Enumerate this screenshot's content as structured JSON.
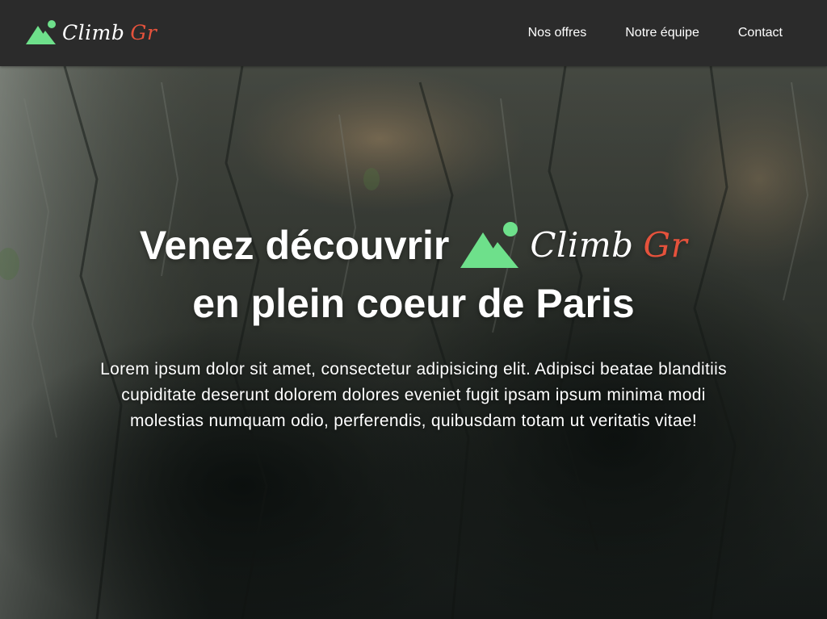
{
  "header": {
    "brand": {
      "logo_icon": "mountain-sun-logo-icon",
      "word1": "Climb",
      "word2": "Gr"
    },
    "nav": [
      "Nos offres",
      "Notre équipe",
      "Contact"
    ]
  },
  "hero": {
    "background": "rock-cliff-photo",
    "headline_part1": "Venez découvrir",
    "inline_logo": {
      "word1": "Climb",
      "word2": "Gr"
    },
    "headline_part2": "en plein coeur de Paris",
    "lead": "Lorem ipsum dolor sit amet, consectetur adipisicing elit. Adipisci beatae blanditiis cupiditate deserunt dolorem dolores eveniet fugit ipsam ipsum minima modi molestias numquam odio, perferendis, quibusdam totam ut veritatis vitae!"
  },
  "colors": {
    "header_bg": "#2b2b2b",
    "logo_green": "#6ee08b",
    "logo_red": "#e5523c",
    "text": "#ffffff"
  }
}
